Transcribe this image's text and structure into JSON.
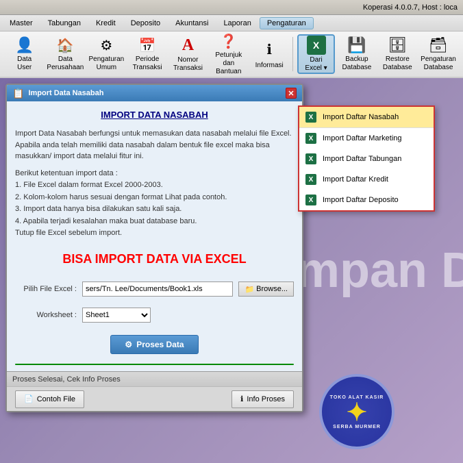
{
  "app": {
    "title": "Koperasi 4.0.0.7, Host : loca"
  },
  "menubar": {
    "items": [
      {
        "label": "Master",
        "active": false
      },
      {
        "label": "Tabungan",
        "active": false
      },
      {
        "label": "Kredit",
        "active": false
      },
      {
        "label": "Deposito",
        "active": false
      },
      {
        "label": "Akuntansi",
        "active": false
      },
      {
        "label": "Laporan",
        "active": false
      },
      {
        "label": "Pengaturan",
        "active": true
      }
    ]
  },
  "toolbar": {
    "buttons": [
      {
        "id": "data-user",
        "label": "Data\nUser",
        "icon": "👤"
      },
      {
        "id": "data-perusahaan",
        "label": "Data\nPerusahaan",
        "icon": "🏠"
      },
      {
        "id": "pengaturan-umum",
        "label": "Pengaturan\nUmum",
        "icon": "⚙"
      },
      {
        "id": "periode-transaksi",
        "label": "Periode\nTransaksi",
        "icon": "📅"
      },
      {
        "id": "nomor-transaksi",
        "label": "Nomor\nTransaksi",
        "icon": "🅰"
      },
      {
        "id": "petunjuk",
        "label": "Petunjuk dan\nBantuan",
        "icon": "❓"
      },
      {
        "id": "informasi",
        "label": "Informasi",
        "icon": "ℹ"
      },
      {
        "id": "dari-excel",
        "label": "Dari\nExcel ▾",
        "icon": "X",
        "active": true
      },
      {
        "id": "backup-database",
        "label": "Backup\nDatabase",
        "icon": "💾"
      },
      {
        "id": "restore-database",
        "label": "Restore\nDatabase",
        "icon": "🗄"
      },
      {
        "id": "pengaturan-database",
        "label": "Pengaturan\nDatabase",
        "icon": "🗃"
      }
    ]
  },
  "dialog": {
    "title": "Import Data Nasabah",
    "heading": "IMPORT DATA NASABAH",
    "description1": "Import Data Nasabah berfungsi untuk memasukan data nasabah melalui file Excel.",
    "description2": "Apabila anda telah memiliki data nasabah dalam bentuk file excel maka bisa masukkan/\nimport data melalui fitur ini.",
    "rules_heading": "Berikut ketentuan import data :",
    "rules": [
      "1. File Excel dalam format Excel 2000-2003.",
      "2. Kolom-kolom harus sesuai dengan format Lihat pada contoh.",
      "3. Import data hanya bisa dilakukan satu kali saja.",
      "4. Apabila terjadi kesalahan maka buat database baru.",
      "   Tutup file Excel sebelum import."
    ],
    "big_text": "BISA IMPORT DATA VIA EXCEL",
    "file_label": "Pilih File Excel :",
    "file_value": "sers/Tn. Lee/Documents/Book1.xls",
    "browse_label": "Browse...",
    "worksheet_label": "Worksheet :",
    "worksheet_value": "Sheet1",
    "process_btn": "Proses Data",
    "status_text": "Proses Selesai, Cek Info Proses",
    "footer": {
      "contoh_btn": "Contoh File",
      "info_btn": "Info Proses"
    }
  },
  "dropdown": {
    "items": [
      {
        "label": "Import Daftar Nasabah",
        "active": true
      },
      {
        "label": "Import Daftar Marketing"
      },
      {
        "label": "Import Daftar Tabungan"
      },
      {
        "label": "Import Daftar Kredit"
      },
      {
        "label": "Import Daftar Deposito"
      }
    ]
  },
  "bg_text": "impan D",
  "watermark": {
    "line1": "TOKO ALAT KASIR",
    "line2": "SERBA MURMER"
  }
}
